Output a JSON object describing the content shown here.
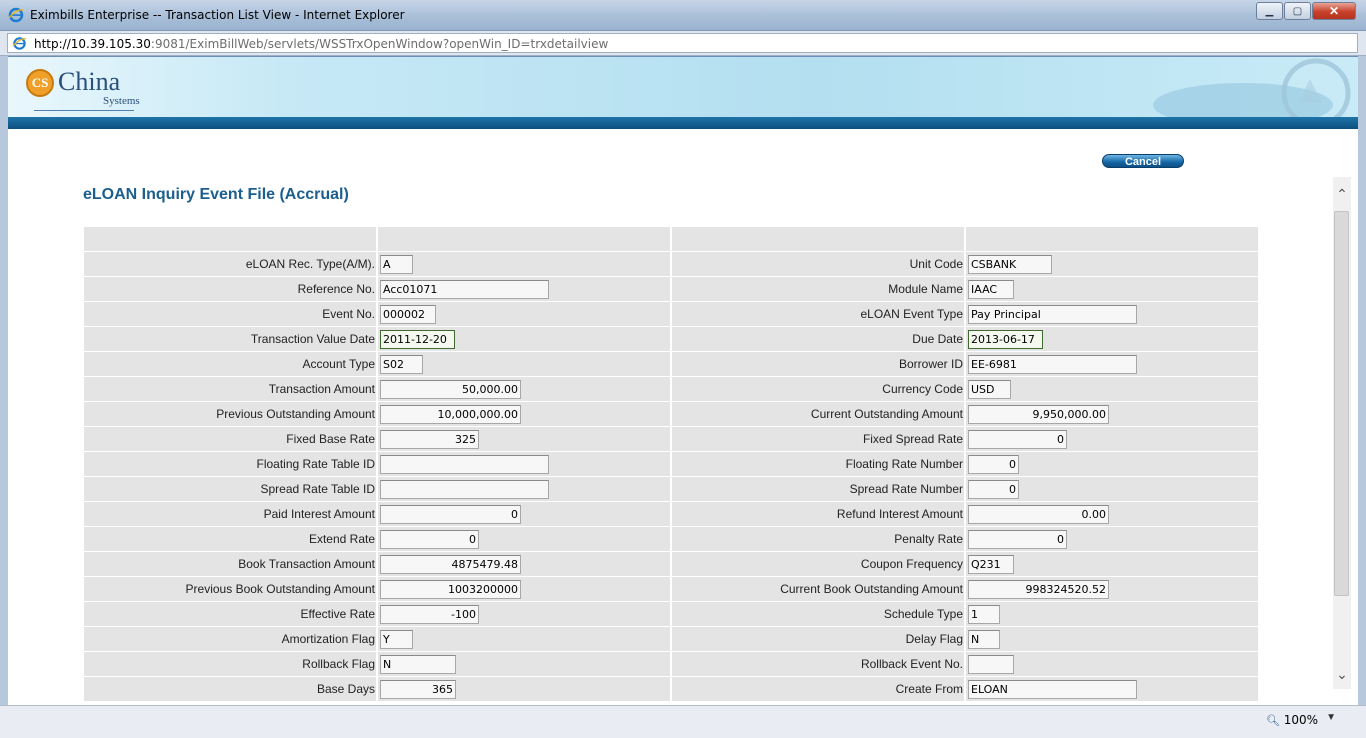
{
  "window": {
    "title": "Eximbills Enterprise -- Transaction List View - Internet Explorer",
    "minimize": "▁",
    "maximize": "▢",
    "close": "✕"
  },
  "address": {
    "url_host": "http://10.39.105.30",
    "url_rest": ":9081/EximBillWeb/servlets/WSSTrxOpenWindow?openWin_ID=trxdetailview"
  },
  "logo": {
    "mark": "CS",
    "name": "China",
    "sub": "Systems"
  },
  "actions": {
    "cancel": "Cancel"
  },
  "page": {
    "title": "eLOAN Inquiry Event File (Accrual)"
  },
  "rows": [
    {
      "l_label": "eLOAN Rec. Type(A/M).",
      "l_value": "A",
      "r_label": "Unit Code",
      "r_value": "CSBANK"
    },
    {
      "l_label": "Reference No.",
      "l_value": "Acc01071",
      "r_label": "Module Name",
      "r_value": "IAAC"
    },
    {
      "l_label": "Event No.",
      "l_value": "000002",
      "r_label": "eLOAN Event Type",
      "r_value": "Pay Principal"
    },
    {
      "l_label": "Transaction Value Date",
      "l_value": "2011-12-20",
      "r_label": "Due Date",
      "r_value": "2013-06-17"
    },
    {
      "l_label": "Account Type",
      "l_value": "S02",
      "r_label": "Borrower ID",
      "r_value": "EE-6981"
    },
    {
      "l_label": "Transaction Amount",
      "l_value": "50,000.00",
      "r_label": "Currency Code",
      "r_value": "USD"
    },
    {
      "l_label": "Previous Outstanding Amount",
      "l_value": "10,000,000.00",
      "r_label": "Current Outstanding Amount",
      "r_value": "9,950,000.00"
    },
    {
      "l_label": "Fixed Base Rate",
      "l_value": "325",
      "r_label": "Fixed Spread Rate",
      "r_value": "0"
    },
    {
      "l_label": "Floating Rate Table ID",
      "l_value": "",
      "r_label": "Floating Rate Number",
      "r_value": "0"
    },
    {
      "l_label": "Spread Rate Table ID",
      "l_value": "",
      "r_label": "Spread Rate Number",
      "r_value": "0"
    },
    {
      "l_label": "Paid Interest Amount",
      "l_value": "0",
      "r_label": "Refund Interest Amount",
      "r_value": "0.00"
    },
    {
      "l_label": "Extend Rate",
      "l_value": "0",
      "r_label": "Penalty Rate",
      "r_value": "0"
    },
    {
      "l_label": "Book Transaction Amount",
      "l_value": "4875479.48",
      "r_label": "Coupon Frequency",
      "r_value": "Q231"
    },
    {
      "l_label": "Previous Book Outstanding Amount",
      "l_value": "1003200000",
      "r_label": "Current Book Outstanding Amount",
      "r_value": "998324520.52"
    },
    {
      "l_label": "Effective Rate",
      "l_value": "-100",
      "r_label": "Schedule Type",
      "r_value": "1"
    },
    {
      "l_label": "Amortization Flag",
      "l_value": "Y",
      "r_label": "Delay Flag",
      "r_value": "N"
    },
    {
      "l_label": "Rollback Flag",
      "l_value": "N",
      "r_label": "Rollback Event No.",
      "r_value": ""
    },
    {
      "l_label": "Base Days",
      "l_value": "365",
      "r_label": "Create From",
      "r_value": "ELOAN"
    }
  ],
  "statusbar": {
    "zoom": "100%",
    "zoom_arrow": "▼"
  },
  "scroll": {
    "up": "⌃",
    "down": "⌄"
  },
  "icons": {
    "browser": "ie-icon",
    "zoom": "zoom-icon"
  }
}
